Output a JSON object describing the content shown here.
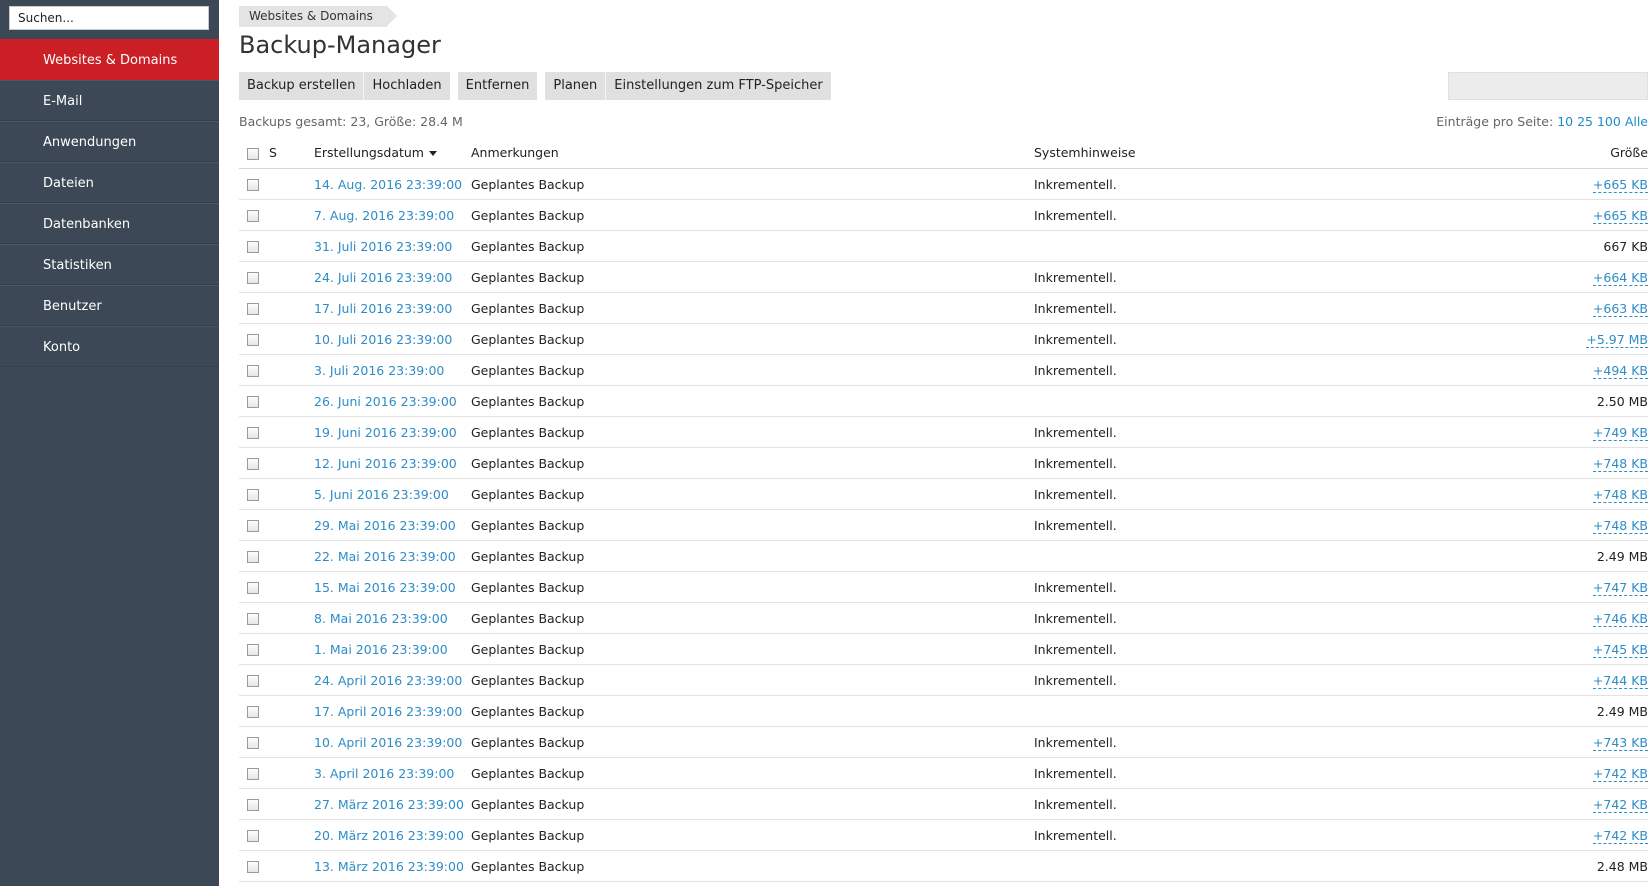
{
  "search": {
    "placeholder": "Suchen..."
  },
  "sidebar": {
    "items": [
      {
        "label": "Websites & Domains",
        "active": true
      },
      {
        "label": "E-Mail"
      },
      {
        "label": "Anwendungen"
      },
      {
        "label": "Dateien"
      },
      {
        "label": "Datenbanken"
      },
      {
        "label": "Statistiken"
      },
      {
        "label": "Benutzer"
      },
      {
        "label": "Konto"
      }
    ]
  },
  "breadcrumb": "Websites & Domains",
  "title": "Backup-Manager",
  "toolbar": {
    "backup_create": "Backup erstellen",
    "upload": "Hochladen",
    "remove": "Entfernen",
    "schedule": "Planen",
    "ftp_settings": "Einstellungen zum FTP-Speicher"
  },
  "summary": "Backups gesamt: 23, Größe: 28.4 M",
  "per_page": {
    "label": "Einträge pro Seite:",
    "opt10": "10",
    "opt25": "25",
    "opt100": "100",
    "all": "Alle"
  },
  "table": {
    "headers": {
      "s": "S",
      "date": "Erstellungsdatum",
      "notes": "Anmerkungen",
      "system": "Systemhinweise",
      "size": "Größe"
    },
    "rows": [
      {
        "date": "14. Aug. 2016 23:39:00",
        "note": "Geplantes Backup",
        "system": "Inkrementell.",
        "size": "+665 KB",
        "size_link": true
      },
      {
        "date": "7. Aug. 2016 23:39:00",
        "note": "Geplantes Backup",
        "system": "Inkrementell.",
        "size": "+665 KB",
        "size_link": true
      },
      {
        "date": "31. Juli 2016 23:39:00",
        "note": "Geplantes Backup",
        "system": "",
        "size": "667 KB",
        "size_link": false
      },
      {
        "date": "24. Juli 2016 23:39:00",
        "note": "Geplantes Backup",
        "system": "Inkrementell.",
        "size": "+664 KB",
        "size_link": true
      },
      {
        "date": "17. Juli 2016 23:39:00",
        "note": "Geplantes Backup",
        "system": "Inkrementell.",
        "size": "+663 KB",
        "size_link": true
      },
      {
        "date": "10. Juli 2016 23:39:00",
        "note": "Geplantes Backup",
        "system": "Inkrementell.",
        "size": "+5.97 MB",
        "size_link": true
      },
      {
        "date": "3. Juli 2016 23:39:00",
        "note": "Geplantes Backup",
        "system": "Inkrementell.",
        "size": "+494 KB",
        "size_link": true
      },
      {
        "date": "26. Juni 2016 23:39:00",
        "note": "Geplantes Backup",
        "system": "",
        "size": "2.50 MB",
        "size_link": false
      },
      {
        "date": "19. Juni 2016 23:39:00",
        "note": "Geplantes Backup",
        "system": "Inkrementell.",
        "size": "+749 KB",
        "size_link": true
      },
      {
        "date": "12. Juni 2016 23:39:00",
        "note": "Geplantes Backup",
        "system": "Inkrementell.",
        "size": "+748 KB",
        "size_link": true
      },
      {
        "date": "5. Juni 2016 23:39:00",
        "note": "Geplantes Backup",
        "system": "Inkrementell.",
        "size": "+748 KB",
        "size_link": true
      },
      {
        "date": "29. Mai 2016 23:39:00",
        "note": "Geplantes Backup",
        "system": "Inkrementell.",
        "size": "+748 KB",
        "size_link": true
      },
      {
        "date": "22. Mai 2016 23:39:00",
        "note": "Geplantes Backup",
        "system": "",
        "size": "2.49 MB",
        "size_link": false
      },
      {
        "date": "15. Mai 2016 23:39:00",
        "note": "Geplantes Backup",
        "system": "Inkrementell.",
        "size": "+747 KB",
        "size_link": true
      },
      {
        "date": "8. Mai 2016 23:39:00",
        "note": "Geplantes Backup",
        "system": "Inkrementell.",
        "size": "+746 KB",
        "size_link": true
      },
      {
        "date": "1. Mai 2016 23:39:00",
        "note": "Geplantes Backup",
        "system": "Inkrementell.",
        "size": "+745 KB",
        "size_link": true
      },
      {
        "date": "24. April 2016 23:39:00",
        "note": "Geplantes Backup",
        "system": "Inkrementell.",
        "size": "+744 KB",
        "size_link": true
      },
      {
        "date": "17. April 2016 23:39:00",
        "note": "Geplantes Backup",
        "system": "",
        "size": "2.49 MB",
        "size_link": false
      },
      {
        "date": "10. April 2016 23:39:00",
        "note": "Geplantes Backup",
        "system": "Inkrementell.",
        "size": "+743 KB",
        "size_link": true
      },
      {
        "date": "3. April 2016 23:39:00",
        "note": "Geplantes Backup",
        "system": "Inkrementell.",
        "size": "+742 KB",
        "size_link": true
      },
      {
        "date": "27. März 2016 23:39:00",
        "note": "Geplantes Backup",
        "system": "Inkrementell.",
        "size": "+742 KB",
        "size_link": true
      },
      {
        "date": "20. März 2016 23:39:00",
        "note": "Geplantes Backup",
        "system": "Inkrementell.",
        "size": "+742 KB",
        "size_link": true
      },
      {
        "date": "13. März 2016 23:39:00",
        "note": "Geplantes Backup",
        "system": "",
        "size": "2.48 MB",
        "size_link": false
      }
    ]
  }
}
